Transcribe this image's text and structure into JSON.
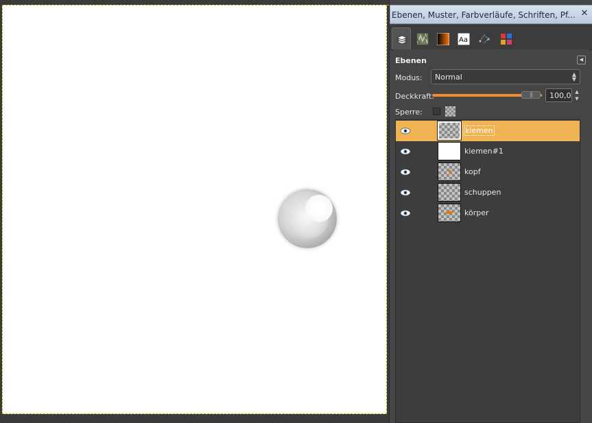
{
  "dock": {
    "title": "Ebenen, Muster, Farbverläufe, Schriften, Pf...",
    "close_icon": "close-icon",
    "tabs": [
      {
        "icon": "layers-icon",
        "active": true
      },
      {
        "icon": "patterns-icon",
        "active": false
      },
      {
        "icon": "gradients-icon",
        "active": false
      },
      {
        "icon": "fonts-icon",
        "text": "Aa",
        "active": false
      },
      {
        "icon": "paths-icon",
        "active": false
      },
      {
        "icon": "colors-icon",
        "active": false
      }
    ]
  },
  "layers_panel": {
    "title": "Ebenen",
    "mode_label": "Modus:",
    "mode_value": "Normal",
    "opacity_label": "Deckkraft:",
    "opacity_value": "100,0",
    "opacity_fraction": 1.0,
    "lock_label": "Sperre:",
    "layers": [
      {
        "name": "kiemen",
        "visible": true,
        "selected": true,
        "thumb": "checker"
      },
      {
        "name": "kiemen#1",
        "visible": true,
        "selected": false,
        "thumb": "white"
      },
      {
        "name": "kopf",
        "visible": true,
        "selected": false,
        "thumb": "checker-dot"
      },
      {
        "name": "schuppen",
        "visible": true,
        "selected": false,
        "thumb": "checker"
      },
      {
        "name": "körper",
        "visible": true,
        "selected": false,
        "thumb": "checker-dot"
      }
    ]
  },
  "colors": {
    "accent": "#f08a2c",
    "selection": "#f0b454",
    "titlebar": "#c9d6e6",
    "guide": "#c8b400"
  }
}
